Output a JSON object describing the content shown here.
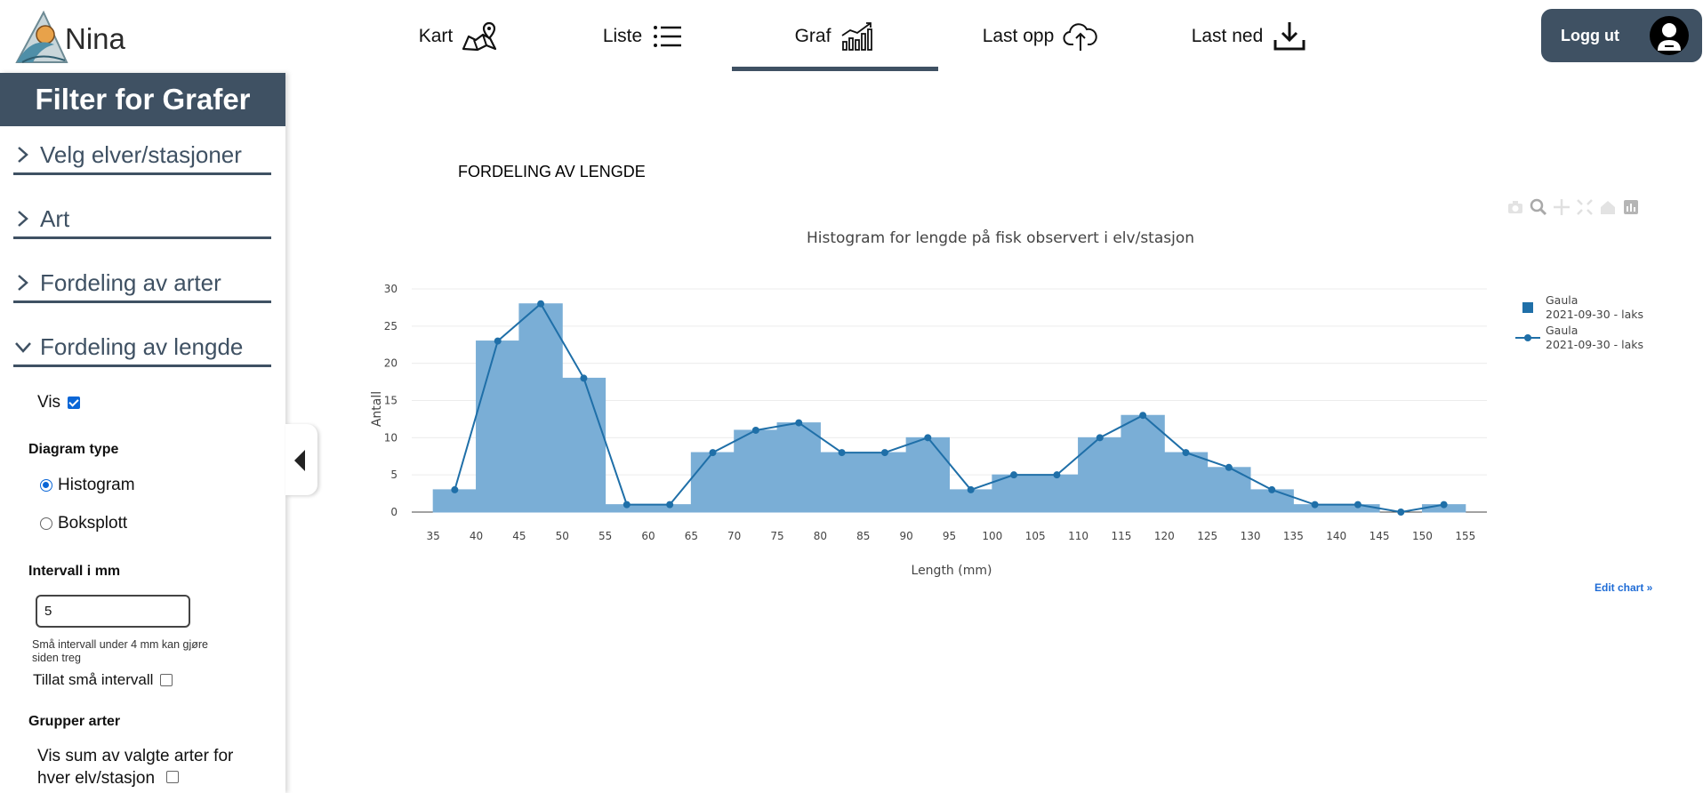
{
  "logo": {
    "text": "Nina"
  },
  "nav": {
    "items": [
      {
        "label": "Kart",
        "icon": "map-icon"
      },
      {
        "label": "Liste",
        "icon": "list-icon"
      },
      {
        "label": "Graf",
        "icon": "bar-chart-icon",
        "active": true
      },
      {
        "label": "Last opp",
        "icon": "cloud-upload-icon"
      },
      {
        "label": "Last ned",
        "icon": "download-icon"
      }
    ],
    "logout": "Logg ut"
  },
  "sidebar": {
    "title": "Filter for Grafer",
    "sections": [
      {
        "label": "Velg elver/stasjoner",
        "expanded": false
      },
      {
        "label": "Art",
        "expanded": false
      },
      {
        "label": "Fordeling av arter",
        "expanded": false
      },
      {
        "label": "Fordeling av lengde",
        "expanded": true
      }
    ],
    "vis_label": "Vis",
    "vis_checked": true,
    "diagram_type_label": "Diagram type",
    "diagram_options": [
      "Histogram",
      "Boksplott"
    ],
    "diagram_selected": "Histogram",
    "interval_label": "Intervall i mm",
    "interval_value": "5",
    "interval_hint": "Små intervall under 4 mm kan gjøre siden treg",
    "allow_small_label": "Tillat små intervall",
    "group_label": "Grupper arter",
    "sum_label": "Vis sum av valgte arter for hver elv/stasjon"
  },
  "panel": {
    "title": "FORDELING AV LENGDE",
    "edit_chart": "Edit chart »"
  },
  "colors": {
    "accent": "#3f5163",
    "bar": "#7aaed6",
    "line": "#1f6fa8",
    "link": "#1f6cd6"
  },
  "chart_data": {
    "type": "bar",
    "title": "Histogram for lengde på fisk observert i elv/stasjon",
    "xlabel": "Length (mm)",
    "ylabel": "Antall",
    "ylim": [
      0,
      30
    ],
    "xlim": [
      32.5,
      157.5
    ],
    "yticks": [
      0,
      5,
      10,
      15,
      20,
      25,
      30
    ],
    "xticks": [
      35,
      40,
      45,
      50,
      55,
      60,
      65,
      70,
      75,
      80,
      85,
      90,
      95,
      100,
      105,
      110,
      115,
      120,
      125,
      130,
      135,
      140,
      145,
      150,
      155
    ],
    "bin_width": 5,
    "bins": [
      35,
      40,
      45,
      50,
      55,
      60,
      65,
      70,
      75,
      80,
      85,
      90,
      95,
      100,
      105,
      110,
      115,
      120,
      125,
      130,
      135,
      140,
      145,
      150
    ],
    "series": [
      {
        "name": "Gaula\n2021-09-30 - laks",
        "kind": "histogram",
        "values": [
          3,
          23,
          28,
          18,
          1,
          1,
          8,
          11,
          12,
          8,
          8,
          10,
          3,
          5,
          5,
          10,
          13,
          8,
          6,
          3,
          1,
          1,
          0,
          1
        ]
      },
      {
        "name": "Gaula\n2021-09-30 - laks",
        "kind": "line",
        "x": [
          37.5,
          42.5,
          47.5,
          52.5,
          57.5,
          62.5,
          67.5,
          72.5,
          77.5,
          82.5,
          87.5,
          92.5,
          97.5,
          102.5,
          107.5,
          112.5,
          117.5,
          122.5,
          127.5,
          132.5,
          137.5,
          142.5,
          147.5,
          152.5
        ],
        "values": [
          3,
          23,
          28,
          18,
          1,
          1,
          8,
          11,
          12,
          8,
          8,
          10,
          3,
          5,
          5,
          10,
          13,
          8,
          6,
          3,
          1,
          1,
          0,
          1
        ]
      }
    ],
    "grid": true,
    "legend_position": "right"
  }
}
